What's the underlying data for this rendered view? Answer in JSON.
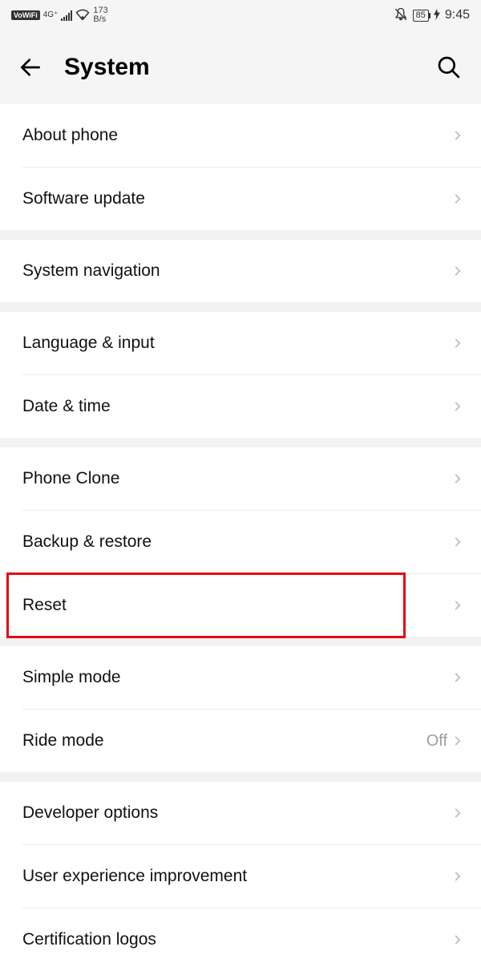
{
  "status": {
    "vowifi": "VoWiFi",
    "network": "4G⁺",
    "speed_value": "173",
    "speed_unit": "B/s",
    "battery": "85",
    "time": "9:45"
  },
  "header": {
    "title": "System"
  },
  "groups": [
    {
      "items": [
        {
          "key": "about-phone",
          "label": "About phone"
        },
        {
          "key": "software-update",
          "label": "Software update"
        }
      ]
    },
    {
      "items": [
        {
          "key": "system-navigation",
          "label": "System navigation"
        }
      ]
    },
    {
      "items": [
        {
          "key": "language-input",
          "label": "Language & input"
        },
        {
          "key": "date-time",
          "label": "Date & time"
        }
      ]
    },
    {
      "items": [
        {
          "key": "phone-clone",
          "label": "Phone Clone"
        },
        {
          "key": "backup-restore",
          "label": "Backup & restore"
        },
        {
          "key": "reset",
          "label": "Reset",
          "highlight": true
        }
      ]
    },
    {
      "items": [
        {
          "key": "simple-mode",
          "label": "Simple mode"
        },
        {
          "key": "ride-mode",
          "label": "Ride mode",
          "value": "Off"
        }
      ]
    },
    {
      "items": [
        {
          "key": "developer-options",
          "label": "Developer options"
        },
        {
          "key": "user-experience-improvement",
          "label": "User experience improvement"
        },
        {
          "key": "certification-logos",
          "label": "Certification logos"
        }
      ]
    }
  ]
}
